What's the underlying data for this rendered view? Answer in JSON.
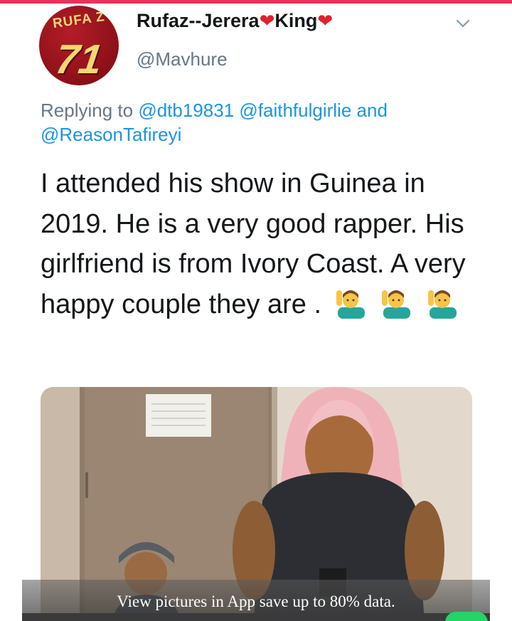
{
  "user": {
    "avatar_text_top": "RUFA Z",
    "avatar_text_number": "71",
    "display_name_part1": "Rufaz--Jerera",
    "display_name_part2": "King",
    "heart_glyph": "❤",
    "handle": "@Mavhure"
  },
  "reply": {
    "prefix": "Replying to",
    "mention_1": "@dtb19831",
    "mention_2": "@faithfulgirlie",
    "conjunction": "and",
    "mention_3": "@ReasonTafireyi"
  },
  "tweet": {
    "text": "I attended his show in Guinea in 2019. He is a very good rapper. His girlfriend is from Ivory Coast. A very happy couple they are ."
  },
  "banner": {
    "text": "View pictures in App save up to 80% data."
  },
  "icons": {
    "menu": "chevron-down-icon",
    "emoji": "person-raising-hand-emoji",
    "emoji_count": 3
  },
  "colors": {
    "link": "#1b95e0",
    "secondary_text": "#657786",
    "heart": "#e0202d",
    "accent_strip": "#e8335a"
  }
}
